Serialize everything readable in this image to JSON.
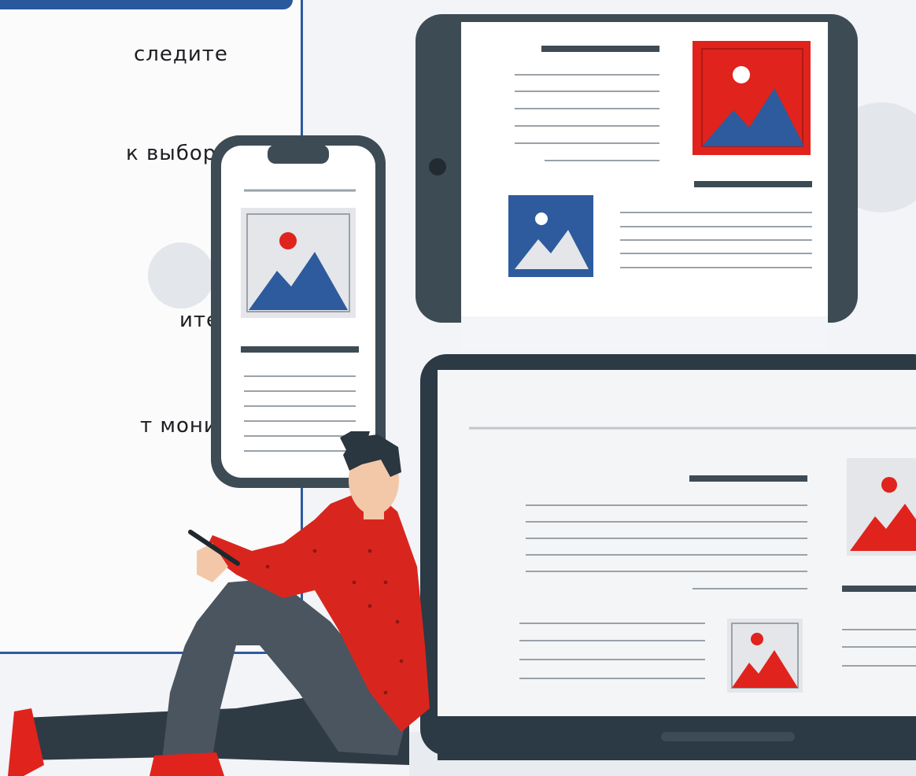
{
  "text_fragments": [
    "следите",
    "к выбору",
    "итесь,",
    "т монитора"
  ],
  "illustration": {
    "subject": "person with phone sitting beside phone, tablet and laptop",
    "colors": {
      "device_frame": "#3d4b55",
      "screen": "#ffffff",
      "accent_red": "#e0231c",
      "accent_blue": "#2d5b9d",
      "panel_border": "#2c5a9e",
      "sweater": "#d8261e",
      "pants": "#4a5560",
      "skin": "#f3c8a8",
      "hair": "#2a3640"
    }
  }
}
